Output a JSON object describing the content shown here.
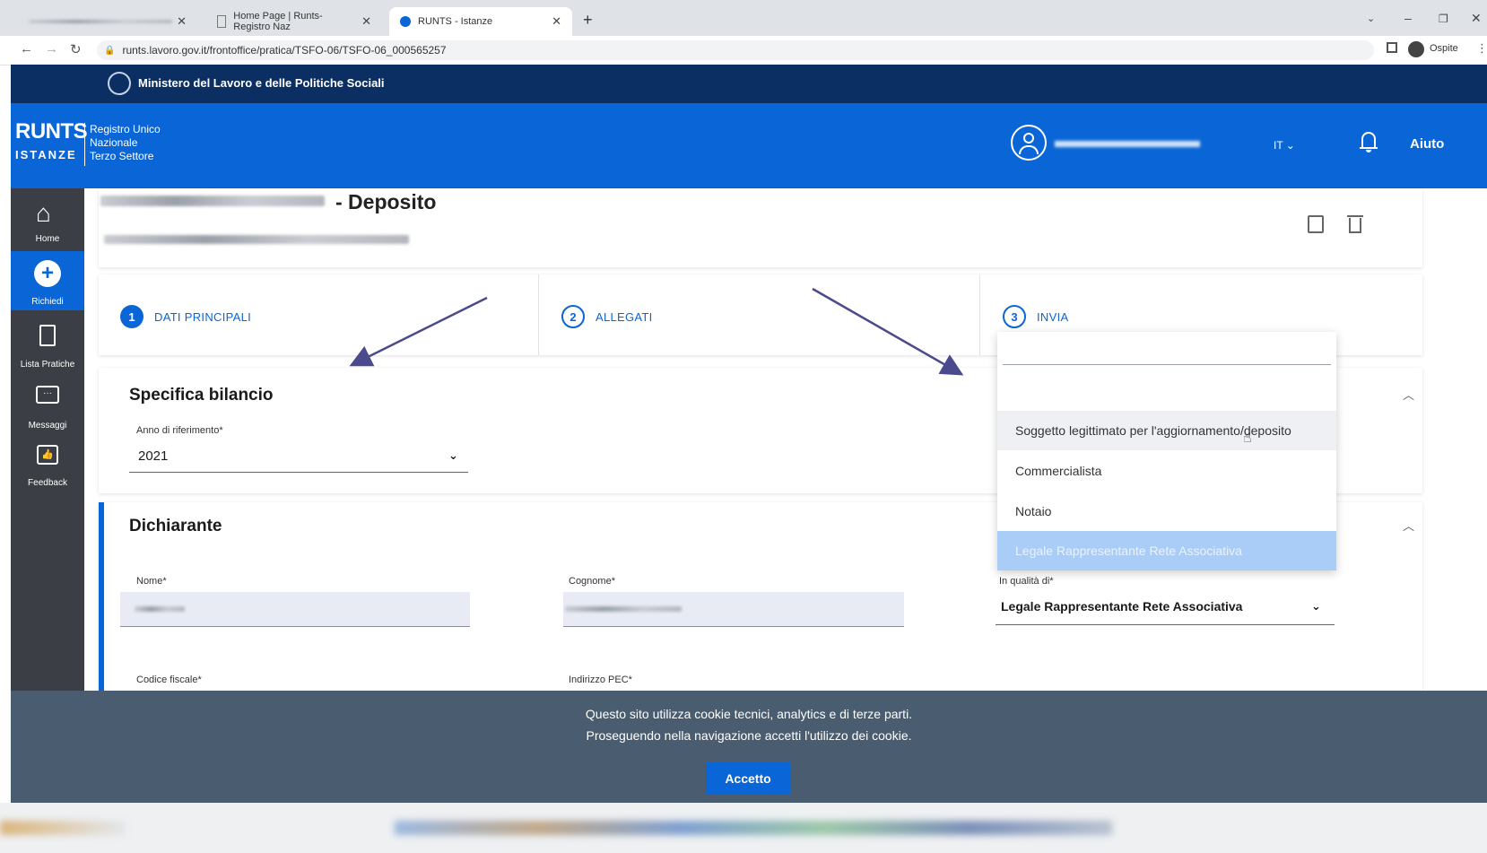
{
  "browser": {
    "tabs": [
      {
        "title": "",
        "active": false
      },
      {
        "title": "Home Page | Runts-Registro Naz",
        "active": false
      },
      {
        "title": "RUNTS - Istanze",
        "active": true
      }
    ],
    "url": "runts.lavoro.gov.it/frontoffice/pratica/TSFO-06/TSFO-06_000565257",
    "profile_label": "Ospite"
  },
  "ministry": {
    "name": "Ministero del Lavoro e delle Politiche Sociali"
  },
  "header": {
    "logo_top": "RUNTS",
    "logo_bottom": "ISTANZE",
    "registry_line1": "Registro Unico",
    "registry_line2": "Nazionale",
    "registry_line3": "Terzo Settore",
    "language": "IT",
    "help": "Aiuto"
  },
  "sidebar": {
    "items": [
      {
        "label": "Home",
        "icon": "home-icon"
      },
      {
        "label": "Richiedi",
        "icon": "plus-circle-icon",
        "active": true
      },
      {
        "label": "Lista Pratiche",
        "icon": "document-icon"
      },
      {
        "label": "Messaggi",
        "icon": "chat-icon"
      },
      {
        "label": "Feedback",
        "icon": "thumbs-up-icon"
      }
    ]
  },
  "page": {
    "title_suffix": "- Deposito"
  },
  "steps": [
    {
      "num": "1",
      "label": "DATI PRINCIPALI"
    },
    {
      "num": "2",
      "label": "ALLEGATI"
    },
    {
      "num": "3",
      "label": "INVIA"
    }
  ],
  "specifica": {
    "title": "Specifica bilancio",
    "anno_label": "Anno di riferimento*",
    "anno_value": "2021"
  },
  "dichiarante": {
    "title": "Dichiarante",
    "nome_label": "Nome*",
    "cognome_label": "Cognome*",
    "qualita_label": "In qualità di*",
    "qualita_value": "Legale Rappresentante Rete Associativa",
    "cf_label": "Codice fiscale*",
    "pec_label": "Indirizzo PEC*"
  },
  "dropdown": {
    "options": [
      "Soggetto legittimato per l'aggiornamento/deposito",
      "Commercialista",
      "Notaio",
      "Legale Rappresentante Rete Associativa"
    ],
    "hovered_index": 0,
    "selected_index": 3
  },
  "cookie": {
    "line1": "Questo sito utilizza cookie tecnici, analytics e di terze parti.",
    "line2": "Proseguendo nella navigazione accetti l'utilizzo dei cookie.",
    "accept": "Accetto"
  },
  "colors": {
    "primary": "#0a66d6",
    "ministry": "#0b2f63",
    "sidebar": "#3b3f45",
    "cookie": "#4a5c70"
  }
}
